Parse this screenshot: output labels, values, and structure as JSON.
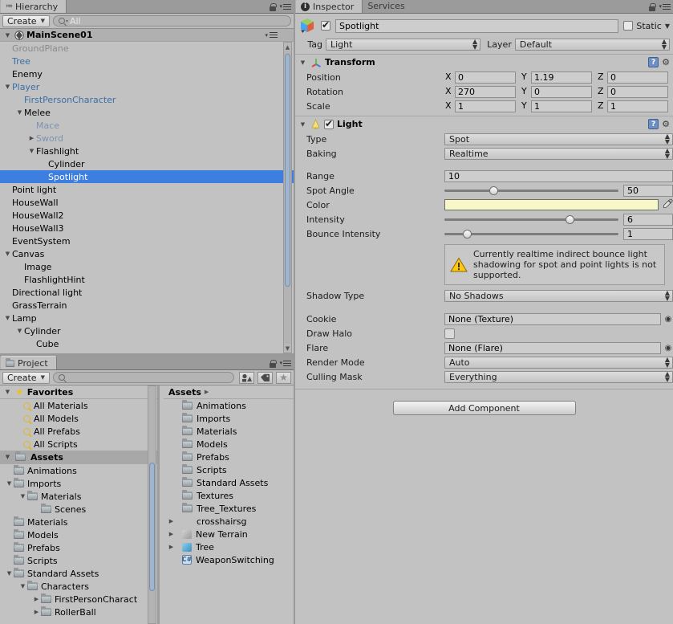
{
  "hierarchy": {
    "tab_label": "Hierarchy",
    "tab_icon": "hierarchy-icon",
    "create_label": "Create",
    "search_value": "All",
    "scene_name": "MainScene01",
    "items": [
      {
        "label": "GroundPlane",
        "depth": 1,
        "arrow": "",
        "style": "inactive"
      },
      {
        "label": "Tree",
        "depth": 1,
        "arrow": "",
        "style": "prefab"
      },
      {
        "label": "Enemy",
        "depth": 1,
        "arrow": "",
        "style": "normal"
      },
      {
        "label": "Player",
        "depth": 1,
        "arrow": "down",
        "style": "prefab"
      },
      {
        "label": "FirstPersonCharacter",
        "depth": 2,
        "arrow": "",
        "style": "prefab"
      },
      {
        "label": "Melee",
        "depth": 2,
        "arrow": "down",
        "style": "normal"
      },
      {
        "label": "Mace",
        "depth": 3,
        "arrow": "",
        "style": "prefab-inactive"
      },
      {
        "label": "Sword",
        "depth": 3,
        "arrow": "right",
        "style": "prefab-inactive"
      },
      {
        "label": "Flashlight",
        "depth": 3,
        "arrow": "down",
        "style": "normal"
      },
      {
        "label": "Cylinder",
        "depth": 4,
        "arrow": "",
        "style": "normal"
      },
      {
        "label": "Spotlight",
        "depth": 4,
        "arrow": "",
        "style": "selected"
      },
      {
        "label": "Point light",
        "depth": 1,
        "arrow": "",
        "style": "normal"
      },
      {
        "label": "HouseWall",
        "depth": 1,
        "arrow": "",
        "style": "normal"
      },
      {
        "label": "HouseWall2",
        "depth": 1,
        "arrow": "",
        "style": "normal"
      },
      {
        "label": "HouseWall3",
        "depth": 1,
        "arrow": "",
        "style": "normal"
      },
      {
        "label": "EventSystem",
        "depth": 1,
        "arrow": "",
        "style": "normal"
      },
      {
        "label": "Canvas",
        "depth": 1,
        "arrow": "down",
        "style": "normal"
      },
      {
        "label": "Image",
        "depth": 2,
        "arrow": "",
        "style": "normal"
      },
      {
        "label": "FlashlightHint",
        "depth": 2,
        "arrow": "",
        "style": "normal"
      },
      {
        "label": "Directional light",
        "depth": 1,
        "arrow": "",
        "style": "normal"
      },
      {
        "label": "GrassTerrain",
        "depth": 1,
        "arrow": "",
        "style": "normal"
      },
      {
        "label": "Lamp",
        "depth": 1,
        "arrow": "down",
        "style": "normal"
      },
      {
        "label": "Cylinder",
        "depth": 2,
        "arrow": "down",
        "style": "normal"
      },
      {
        "label": "Cube",
        "depth": 3,
        "arrow": "",
        "style": "normal"
      }
    ]
  },
  "project": {
    "tab_label": "Project",
    "tab_icon": "folder-icon",
    "create_label": "Create",
    "search_value": "",
    "toolbar_icons": [
      "filter-by-type-icon",
      "filter-by-label-icon",
      "favorite-star-icon"
    ],
    "favorites": {
      "label": "Favorites",
      "items": [
        "All Materials",
        "All Models",
        "All Prefabs",
        "All Scripts"
      ]
    },
    "assets_tree": {
      "root_label": "Assets",
      "items": [
        {
          "label": "Animations",
          "depth": 1,
          "arrow": ""
        },
        {
          "label": "Imports",
          "depth": 1,
          "arrow": "down"
        },
        {
          "label": "Materials",
          "depth": 2,
          "arrow": "down"
        },
        {
          "label": "Scenes",
          "depth": 3,
          "arrow": ""
        },
        {
          "label": "Materials",
          "depth": 1,
          "arrow": ""
        },
        {
          "label": "Models",
          "depth": 1,
          "arrow": ""
        },
        {
          "label": "Prefabs",
          "depth": 1,
          "arrow": ""
        },
        {
          "label": "Scripts",
          "depth": 1,
          "arrow": ""
        },
        {
          "label": "Standard Assets",
          "depth": 1,
          "arrow": "down"
        },
        {
          "label": "Characters",
          "depth": 2,
          "arrow": "down"
        },
        {
          "label": "FirstPersonCharact",
          "depth": 3,
          "arrow": "right"
        },
        {
          "label": "RollerBall",
          "depth": 3,
          "arrow": "right"
        }
      ]
    },
    "breadcrumb": "Assets",
    "contents": [
      {
        "label": "Animations",
        "icon": "folder-icon",
        "arrow": ""
      },
      {
        "label": "Imports",
        "icon": "folder-icon",
        "arrow": ""
      },
      {
        "label": "Materials",
        "icon": "folder-icon",
        "arrow": ""
      },
      {
        "label": "Models",
        "icon": "folder-icon",
        "arrow": ""
      },
      {
        "label": "Prefabs",
        "icon": "folder-icon",
        "arrow": ""
      },
      {
        "label": "Scripts",
        "icon": "folder-icon",
        "arrow": ""
      },
      {
        "label": "Standard Assets",
        "icon": "folder-icon",
        "arrow": ""
      },
      {
        "label": "Textures",
        "icon": "folder-icon",
        "arrow": ""
      },
      {
        "label": "Tree_Textures",
        "icon": "folder-icon",
        "arrow": ""
      },
      {
        "label": "crosshairsg",
        "icon": "none-icon",
        "arrow": "right"
      },
      {
        "label": "New Terrain",
        "icon": "terrain-icon",
        "arrow": "right"
      },
      {
        "label": "Tree",
        "icon": "prefab-cube-icon",
        "arrow": "right"
      },
      {
        "label": "WeaponSwitching",
        "icon": "csharp-script-icon",
        "arrow": ""
      }
    ]
  },
  "inspector": {
    "tabs": [
      {
        "label": "Inspector",
        "active": true,
        "icon": "info-icon"
      },
      {
        "label": "Services",
        "active": false,
        "icon": ""
      }
    ],
    "object": {
      "icon": "gameobject-icon",
      "enabled": true,
      "name": "Spotlight",
      "static_label": "Static",
      "static_checked": false,
      "tag_label": "Tag",
      "tag_value": "Light",
      "layer_label": "Layer",
      "layer_value": "Default"
    },
    "transform": {
      "title": "Transform",
      "icon": "transform-axis-icon",
      "rows": [
        {
          "name": "Position",
          "x": "0",
          "y": "1.19",
          "z": "0"
        },
        {
          "name": "Rotation",
          "x": "270",
          "y": "0",
          "z": "0"
        },
        {
          "name": "Scale",
          "x": "1",
          "y": "1",
          "z": "1"
        }
      ],
      "axis_labels": [
        "X",
        "Y",
        "Z"
      ]
    },
    "light": {
      "title": "Light",
      "icon": "light-bulb-icon",
      "enabled": true,
      "type_label": "Type",
      "type_value": "Spot",
      "baking_label": "Baking",
      "baking_value": "Realtime",
      "range_label": "Range",
      "range_value": "10",
      "spot_angle_label": "Spot Angle",
      "spot_angle_value": "50",
      "spot_angle_pct": 28,
      "color_label": "Color",
      "color_value": "#F7F7C8",
      "eyedropper_icon": "eyedropper-icon",
      "intensity_label": "Intensity",
      "intensity_value": "6",
      "intensity_pct": 72,
      "bounce_label": "Bounce Intensity",
      "bounce_value": "1",
      "bounce_pct": 13,
      "warning_icon": "warning-triangle-icon",
      "warning_text": "Currently realtime indirect bounce light shadowing for spot and point lights is not supported.",
      "shadow_type_label": "Shadow Type",
      "shadow_type_value": "No Shadows",
      "cookie_label": "Cookie",
      "cookie_value": "None (Texture)",
      "draw_halo_label": "Draw Halo",
      "draw_halo_checked": false,
      "flare_label": "Flare",
      "flare_value": "None (Flare)",
      "render_mode_label": "Render Mode",
      "render_mode_value": "Auto",
      "culling_mask_label": "Culling Mask",
      "culling_mask_value": "Everything"
    },
    "add_component_label": "Add Component"
  },
  "colors": {
    "selection_blue": "#3d7fe0",
    "panel_bg": "#c2c2c2",
    "prefab_blue": "#3b6ea5",
    "light_color": "#F7F7C8",
    "warning_yellow": "#ffc80a"
  }
}
